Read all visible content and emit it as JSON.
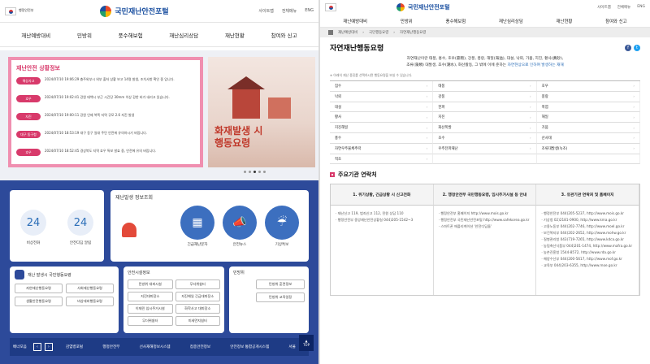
{
  "left": {
    "gov_logo_text": "행정안전부",
    "site_name": "국민재난안전포털",
    "util_links": [
      "사이트맵",
      "전체메뉴",
      "ENG"
    ],
    "nav": [
      "재난예방대비",
      "민방위",
      "풍수해보험",
      "재난심리상담",
      "재난현황",
      "참여와 신고"
    ],
    "alert": {
      "title": "재난안전 상황정보",
      "items": [
        {
          "tag": "해상사고",
          "text": "2024/07/10 19:06:29 충주외부시 외부 출처 상황 보고 14명 발생, 조치사항 확인 중 입니다."
        },
        {
          "tag": "호우",
          "text": "2024/07/10 19:02:41 강원 태백시 부근 시간당 30mm 이상 강한 비가 내리고 있습니다."
        },
        {
          "tag": "지진",
          "text": "2024/07/10 19:00:11 강원 인제 북쪽 지역 규모 2.6 지진 발생"
        },
        {
          "tag": "대구 동구청",
          "text": "2024/07/10 18:53:19 대구 동구 일대 주민 안전에 유의하시기 바랍니다."
        },
        {
          "tag": "호우",
          "text": "2024/07/10 18:52:45 경상북도 지역 호우 특보 발효 중, 안전에 유의 바랍니다."
        }
      ]
    },
    "fire_ad": "화재발생 시\n행동요령",
    "quick": [
      {
        "icon": "24",
        "label": "비상전화"
      },
      {
        "icon": "24",
        "label": "안전디딤 알림"
      }
    ],
    "info_title": "재난발생 정보조회",
    "info_icons": [
      {
        "glyph": "▦",
        "label": "긴급재난문자"
      },
      {
        "glyph": "📣",
        "label": "안전뉴스"
      },
      {
        "glyph": "☔",
        "label": "기상특보"
      }
    ],
    "guide_title": "재난 발생시 국민행동요령",
    "guide_buttons": [
      "자연재난행동요령",
      "사회재난행동요령",
      "생활안전행동요령",
      "비상대비행동요령"
    ],
    "facility_title": "안전시설정보",
    "facility_buttons": [
      "민방위 대피시설",
      "무더위쉼터",
      "지진대피장소",
      "지진해일 긴급대피장소",
      "이재민 임시주거시설",
      "화학사고 대피장소",
      "무더위쉼터",
      "미세먼지쉼터"
    ],
    "civil_title": "민방위",
    "civil_buttons": [
      "민방위 훈련정보",
      "민방위 교육일정"
    ],
    "footer_label": "배너모음",
    "footer_links": [
      "감염병포털",
      "행정안전부",
      "선사재해정보시스템",
      "접종안전정보",
      "안전정보 통합공개시스템",
      "서울"
    ],
    "top_label": "TOP"
  },
  "right": {
    "site_name": "국민재난안전포털",
    "util_links": [
      "사이트맵",
      "전체메뉴",
      "ENG"
    ],
    "nav": [
      "재난예방대비",
      "민방위",
      "풍수해보험",
      "재난심리상담",
      "재난현황",
      "참여와 신고"
    ],
    "breadcrumb": [
      "재난예방대비",
      "국민행동요령",
      "자연재난행동요령"
    ],
    "title": "자연재난행동요령",
    "definition_1": "자연재난이란 태풍, 홍수, 호우(豪雨), 강풍, 풍랑, 해일(海溢), 대설, 낙뢰, 가뭄, 지진, 황사(黃砂),",
    "definition_2": "조류(藻類) 대발생, 조수(潮水), 화산활동, 그 밖에 이에 준하는",
    "definition_hl": "자연현상으로 인하여 발생하는 재해",
    "note": "※ 아래의 재난 종류를 선택하시면 행동요령을 보실 수 있습니다.",
    "disasters": [
      "침수",
      "태풍",
      "호우",
      "낙뢰",
      "강풍",
      "풍랑",
      "대설",
      "한파",
      "폭염",
      "황사",
      "지진",
      "해일",
      "지진해일",
      "화산폭발",
      "가뭄",
      "홍수",
      "조수",
      "산사태",
      "자연우주물체추락",
      "우주전파재난",
      "조류대발생(녹조)",
      "적조"
    ],
    "contacts_title": "주요기관 연락처",
    "contacts": [
      {
        "head": "1. 위기상황, 긴급상황 시 신고전화",
        "lines": [
          "재난신고 119, 범죄신고 112, 민원 상담 110",
          "행정안전부 중앙재난안전상황실 044)205-1542~3"
        ]
      },
      {
        "head": "2. 행정안전부 국민행동요령, 임시주거시설 등 안내",
        "lines": [
          "행정안전부 홈페이지 http://www.mois.go.kr",
          "행정안전부 국민재난안전포털 http://www.safekorea.go.kr",
          "스마트폰 애플리케이션 '안전디딤돌'"
        ]
      },
      {
        "head": "3. 유관기관 연락처 및 홈페이지",
        "lines": [
          "행정안전부 044)205-5237, http://www.mois.go.kr",
          "기상청 02)2181-0900, http://www.kma.go.kr",
          "고용노동부 044)202-7746, http://www.moel.go.kr",
          "보건복지부 044)202-2652, http://www.mohw.go.kr",
          "질병관리청 043)719-7265, http://www.kdca.go.kr",
          "농림축산식품부 044)201-1474, http://www.mafra.go.kr",
          "농촌진흥청 1544-8572, http://www.rda.go.kr",
          "해양수산부 044)200-5617, http://www.mof.go.kr",
          "교육부 044)203-6355, http://www.moe.go.kr"
        ]
      }
    ]
  },
  "colors": {
    "accent_pink": "#d83a6b",
    "brand_blue": "#1a4fa0",
    "panel_navy": "#2d4a9a"
  }
}
